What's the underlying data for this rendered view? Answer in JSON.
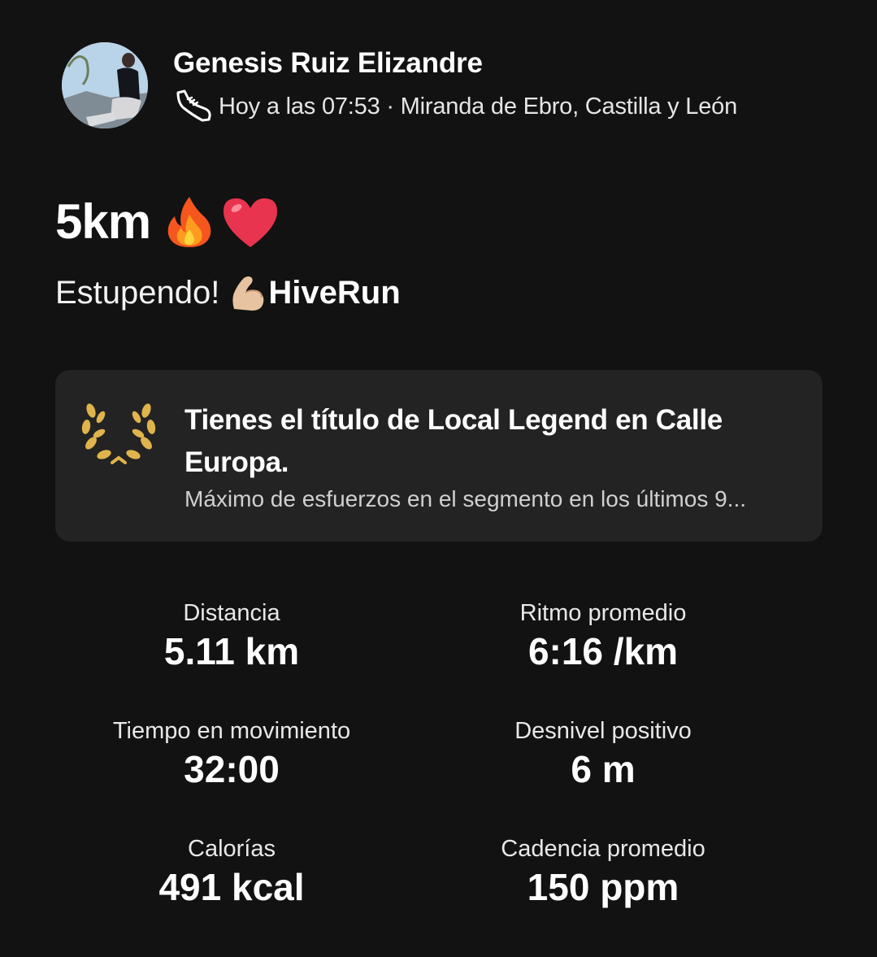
{
  "athlete": {
    "name": "Genesis Ruiz Elizandre",
    "meta": "Hoy a las 07:53 · Miranda de Ebro, Castilla y León",
    "activity_icon": "running-shoe-icon"
  },
  "activity": {
    "title": "5km",
    "title_emojis": [
      "fire-emoji",
      "heart-emoji"
    ],
    "description_prefix": "Estupendo!",
    "description_emoji": "flexed-biceps-emoji",
    "description_suffix": "HiveRun"
  },
  "local_legend": {
    "icon": "laurel-wreath-icon",
    "icon_color": "#E0B44C",
    "title": "Tienes el título de Local Legend en Calle Europa.",
    "subtitle": "Máximo de esfuerzos en el segmento en los últimos 9..."
  },
  "stats": [
    {
      "label": "Distancia",
      "value": "5.11 km"
    },
    {
      "label": "Ritmo promedio",
      "value": "6:16 /km"
    },
    {
      "label": "Tiempo en movimiento",
      "value": "32:00"
    },
    {
      "label": "Desnivel positivo",
      "value": "6 m"
    },
    {
      "label": "Calorías",
      "value": "491 kcal"
    },
    {
      "label": "Cadencia promedio",
      "value": "150 ppm"
    }
  ],
  "colors": {
    "background": "#121212",
    "card": "#232323",
    "text": "#FFFFFF"
  }
}
